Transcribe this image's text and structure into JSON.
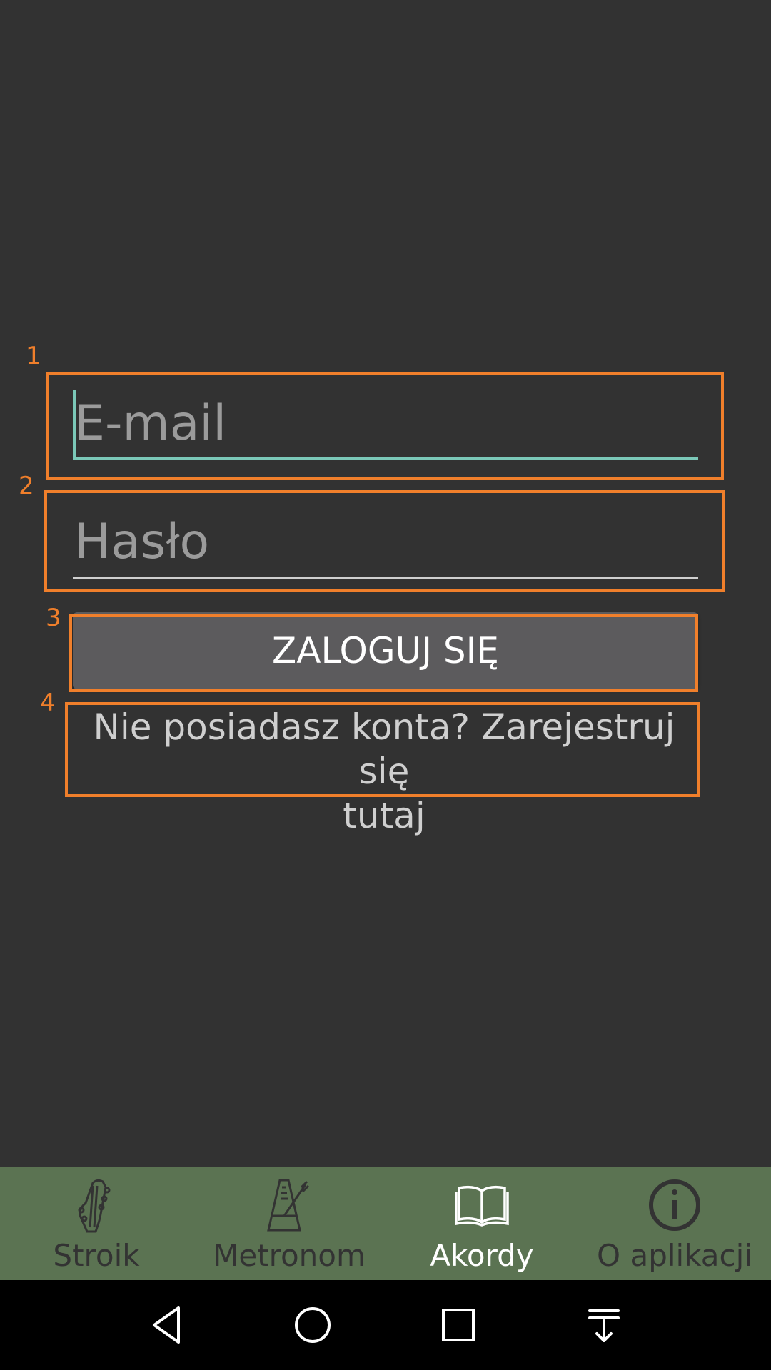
{
  "login": {
    "email_placeholder": "E-mail",
    "password_placeholder": "Hasło",
    "login_button": "ZALOGUJ SIĘ",
    "register_line1": "Nie posiadasz konta? Zarejestruj się",
    "register_line2": "tutaj"
  },
  "annotations": [
    "1",
    "2",
    "3",
    "4"
  ],
  "bottom_nav": {
    "items": [
      {
        "label": "Stroik",
        "icon": "guitar-headstock-icon",
        "active": false
      },
      {
        "label": "Metronom",
        "icon": "metronome-icon",
        "active": false
      },
      {
        "label": "Akordy",
        "icon": "open-book-icon",
        "active": true
      },
      {
        "label": "O aplikacji",
        "icon": "info-icon",
        "active": false
      }
    ]
  },
  "system_nav": {
    "buttons": [
      "back-icon",
      "home-icon",
      "recents-icon",
      "notifications-down-icon"
    ]
  },
  "colors": {
    "background": "#323232",
    "accent": "#7bc8b8",
    "annotation": "#f07f2b",
    "nav_bar": "#5b7352",
    "button": "#5c5b5d"
  }
}
